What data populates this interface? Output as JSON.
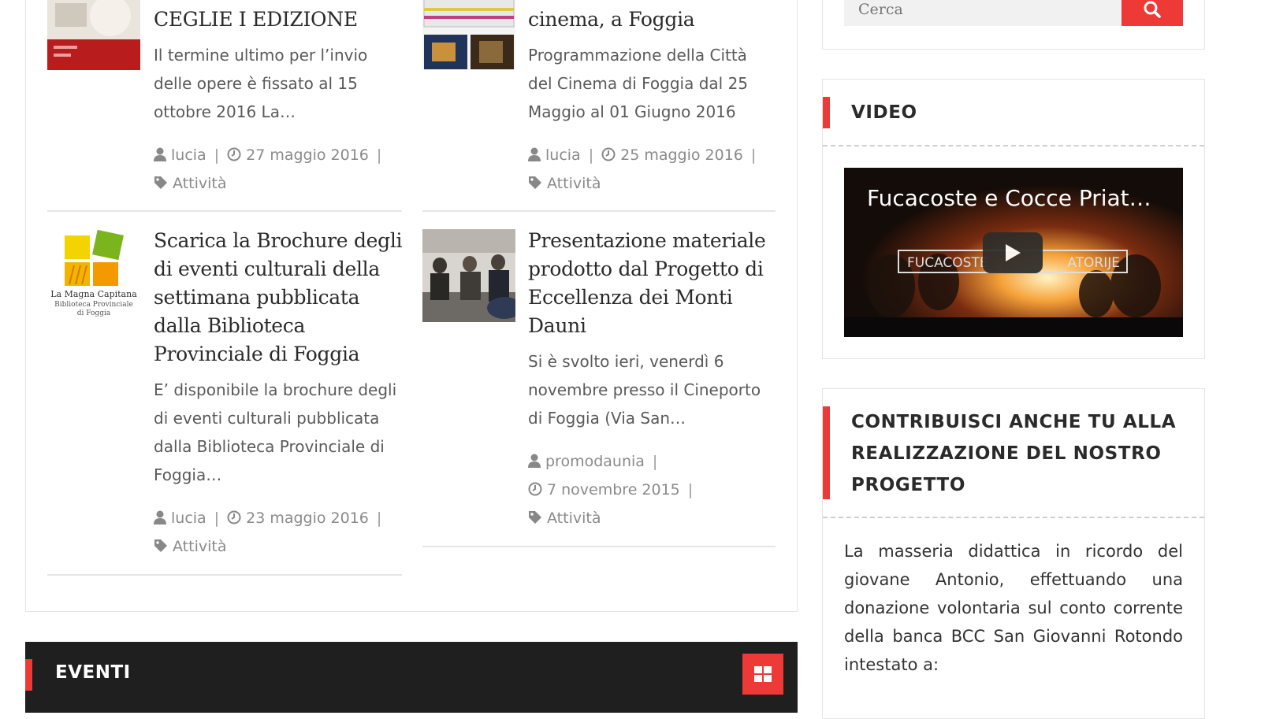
{
  "posts": [
    {
      "title": "CEGLIE I EDIZIONE",
      "excerpt": "Il termine ultimo per l’invio delle opere è fissato al 15 ottobre 2016 La…",
      "author": "lucia",
      "date": "27 maggio 2016",
      "category": "Attività"
    },
    {
      "title": "cinema, a Foggia",
      "excerpt": "Programmazione della Città del Cinema di Foggia dal 25 Maggio al 01 Giugno 2016",
      "author": "lucia",
      "date": "25 maggio 2016",
      "category": "Attività"
    },
    {
      "title": "Scarica la Brochure degli di eventi culturali della settimana pubblicata dalla Biblioteca Provinciale di Foggia",
      "excerpt": "E’ disponibile la brochure degli di eventi culturali pubblicata dalla Biblioteca Provinciale di Foggia…",
      "author": "lucia",
      "date": "23 maggio 2016",
      "category": "Attività",
      "logo_lines": [
        "La Magna Capitana",
        "Biblioteca Provinciale",
        "di Foggia"
      ]
    },
    {
      "title": "Presentazione materiale prodotto dal Progetto di Eccellenza dei Monti Dauni",
      "excerpt": "Si è svolto ieri, venerdì 6 novembre presso il Cineporto di Foggia (Via San…",
      "author": "promodaunia",
      "date": "7 novembre 2015",
      "category": "Attività"
    }
  ],
  "eventi": {
    "title": "EVENTI",
    "icon": "grid-icon"
  },
  "sidebar": {
    "search": {
      "placeholder": "Cerca",
      "icon": "search-icon"
    },
    "video": {
      "title": "VIDEO",
      "video_title": "Fucacoste e Cocce Priat…",
      "caption_left": "FUCACOSTE",
      "caption_right": "ATORIJE"
    },
    "contrib": {
      "title": "CONTRIBUISCI ANCHE TU ALLA REALIZZAZIONE DEL NOSTRO PROGETTO",
      "text": "La masseria didattica in ricordo del giovane Antonio, effettuando una donazione volontaria sul conto corrente della banca BCC San Giovanni Rotondo intestato a:"
    }
  },
  "colors": {
    "accent": "#ee3a36",
    "dark_bar": "#1f1f1f",
    "meta": "#8a8a8a"
  }
}
